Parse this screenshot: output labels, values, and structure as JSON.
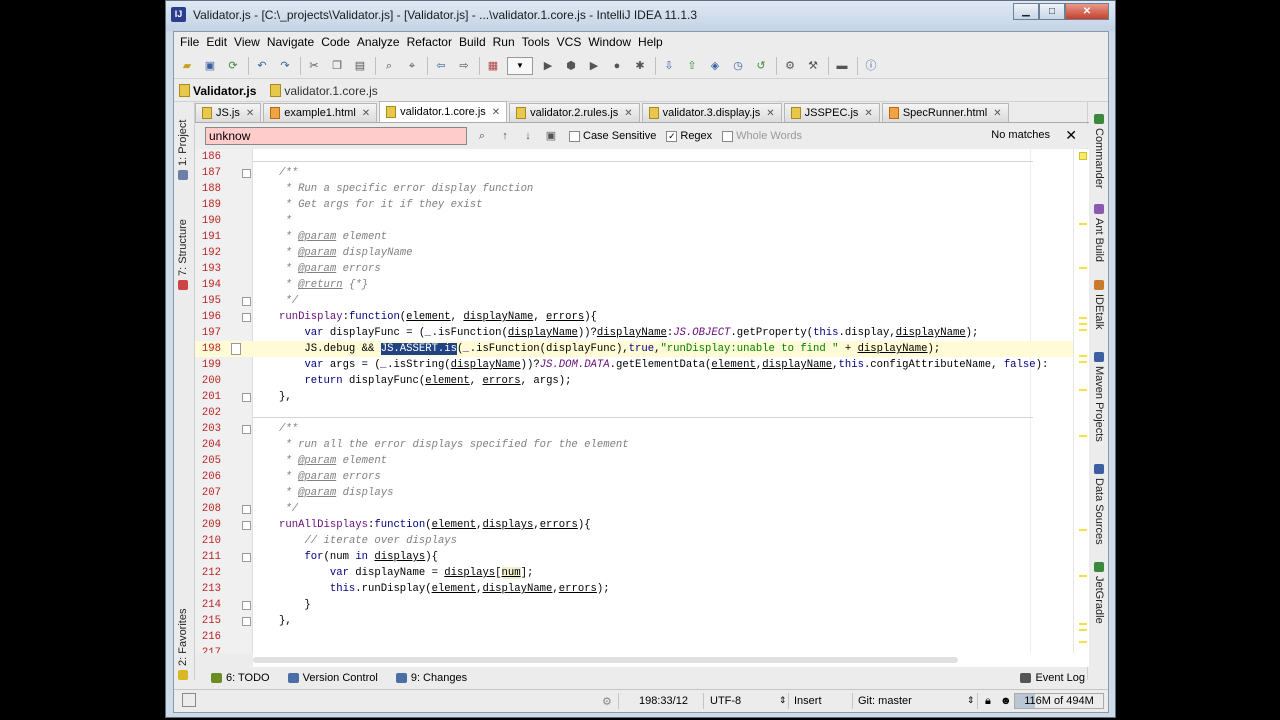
{
  "window": {
    "title": "Validator.js - [C:\\_projects\\Validator.js] - [Validator.js] - ...\\validator.1.core.js - IntelliJ IDEA 11.1.3",
    "controls": [
      "▁",
      "□",
      "✕"
    ]
  },
  "menu": [
    "File",
    "Edit",
    "View",
    "Navigate",
    "Code",
    "Analyze",
    "Refactor",
    "Build",
    "Run",
    "Tools",
    "VCS",
    "Window",
    "Help"
  ],
  "navbar": {
    "project": "Validator.js",
    "file": "validator.1.core.js"
  },
  "tabs": [
    {
      "label": "JS.js",
      "type": "js"
    },
    {
      "label": "example1.html",
      "type": "html"
    },
    {
      "label": "validator.1.core.js",
      "type": "js",
      "active": true
    },
    {
      "label": "validator.2.rules.js",
      "type": "js"
    },
    {
      "label": "validator.3.display.js",
      "type": "js"
    },
    {
      "label": "JSSPEC.js",
      "type": "js"
    },
    {
      "label": "SpecRunner.html",
      "type": "html"
    }
  ],
  "find": {
    "value": "unknow",
    "case_sensitive": {
      "label": "Case Sensitive",
      "checked": false
    },
    "regex": {
      "label": "Regex",
      "checked": true
    },
    "whole_words": {
      "label": "Whole Words",
      "checked": false
    },
    "status": "No matches"
  },
  "left_panels": [
    "1: Project",
    "7: Structure",
    "2: Favorites"
  ],
  "right_panels": [
    "Commander",
    "Ant Build",
    "IDEtalk",
    "Maven Projects",
    "Data Sources",
    "JetGradle"
  ],
  "code": {
    "current_line": "198",
    "line_numbers": [
      "186",
      "187",
      "188",
      "189",
      "190",
      "191",
      "192",
      "193",
      "194",
      "195",
      "196",
      "197",
      "198",
      "199",
      "200",
      "201",
      "202",
      "203",
      "204",
      "205",
      "206",
      "207",
      "208",
      "209",
      "210",
      "211",
      "212",
      "213",
      "214",
      "215",
      "216",
      "217"
    ],
    "c187": "/**",
    "c188": " * Run a specific error display function",
    "c189": " * Get args for it if they exist",
    "c190": " *",
    "c191a": " * ",
    "c191b": "@param",
    "c191c": " element",
    "c192a": " * ",
    "c192b": "@param",
    "c192c": " displayName",
    "c193a": " * ",
    "c193b": "@param",
    "c193c": " errors",
    "c194a": " * ",
    "c194b": "@return",
    "c194c": " {*}",
    "c195": " */",
    "c196a": "runDisplay",
    "c196b": ":",
    "c196c": "function",
    "c196d": "(",
    "c196e": "element",
    "c196f": ", ",
    "c196g": "displayName",
    "c196h": ", ",
    "c196i": "errors",
    "c196j": "){",
    "c197a": "    ",
    "c197b": "var",
    "c197c": " displayFunc = (",
    "c197d": "_",
    "c197e": ".isFunction(",
    "c197f": "displayName",
    "c197g": "))?",
    "c197h": "displayName",
    "c197i": ":",
    "c197j": "JS.OBJECT",
    "c197k": ".getProperty(",
    "c197l": "this",
    "c197m": ".display,",
    "c197n": "displayName",
    "c197o": ");",
    "c198a": "    JS.debug && ",
    "c198b": "JS.ASSERT.is",
    "c198c": "(",
    "c198d": "_",
    "c198e": ".isFunction(displayFunc),",
    "c198f": "true",
    "c198g": ",",
    "c198h": "\"runDisplay:unable to find \"",
    "c198i": " + ",
    "c198j": "displayName",
    "c198k": ");",
    "c199a": "    ",
    "c199b": "var",
    "c199c": " args = (",
    "c199d": "_",
    "c199e": ".isString(",
    "c199f": "displayName",
    "c199g": "))?",
    "c199h": "JS.DOM.DATA",
    "c199i": ".getElementData(",
    "c199j": "element",
    "c199k": ",",
    "c199l": "displayName",
    "c199m": ",",
    "c199n": "this",
    "c199o": ".configAttributeName, ",
    "c199p": "false",
    "c199q": "):",
    "c200a": "    ",
    "c200b": "return",
    "c200c": " displayFunc(",
    "c200d": "element",
    "c200e": ", ",
    "c200f": "errors",
    "c200g": ", args);",
    "c201": "},",
    "c203": "/**",
    "c204": " * run all the error displays specified for the element",
    "c205a": " * ",
    "c205b": "@param",
    "c205c": " element",
    "c206a": " * ",
    "c206b": "@param",
    "c206c": " errors",
    "c207a": " * ",
    "c207b": "@param",
    "c207c": " displays",
    "c208": " */",
    "c209a": "runAllDisplays",
    "c209b": ":",
    "c209c": "function",
    "c209d": "(",
    "c209e": "element",
    "c209f": ",",
    "c209g": "displays",
    "c209h": ",",
    "c209i": "errors",
    "c209j": "){",
    "c210a": "    ",
    "c210b": "// iterate over displays",
    "c211a": "    ",
    "c211b": "for",
    "c211c": "(num ",
    "c211d": "in",
    "c211e": " ",
    "c211f": "displays",
    "c211g": "){",
    "c212a": "        ",
    "c212b": "var",
    "c212c": " displayName = ",
    "c212d": "displays",
    "c212e": "[",
    "c212f": "num",
    "c212g": "];",
    "c213a": "        ",
    "c213b": "this",
    "c213c": ".runDisplay(",
    "c213d": "element",
    "c213e": ",",
    "c213f": "displayName",
    "c213g": ",",
    "c213h": "errors",
    "c213i": ");",
    "c214": "    }",
    "c215": "},"
  },
  "bottom_tabs": [
    {
      "label": "6: TODO",
      "color": "#6b8e23"
    },
    {
      "label": "Version Control",
      "color": "#4a6fa5"
    },
    {
      "label": "9: Changes",
      "color": "#4a6fa5"
    }
  ],
  "event_log": "Event Log",
  "status": {
    "position": "198:33/12",
    "encoding": "UTF-8",
    "mode": "Insert",
    "vcs": "Git: master",
    "memory": "116M of 494M",
    "memory_used_fraction": 0.23
  }
}
